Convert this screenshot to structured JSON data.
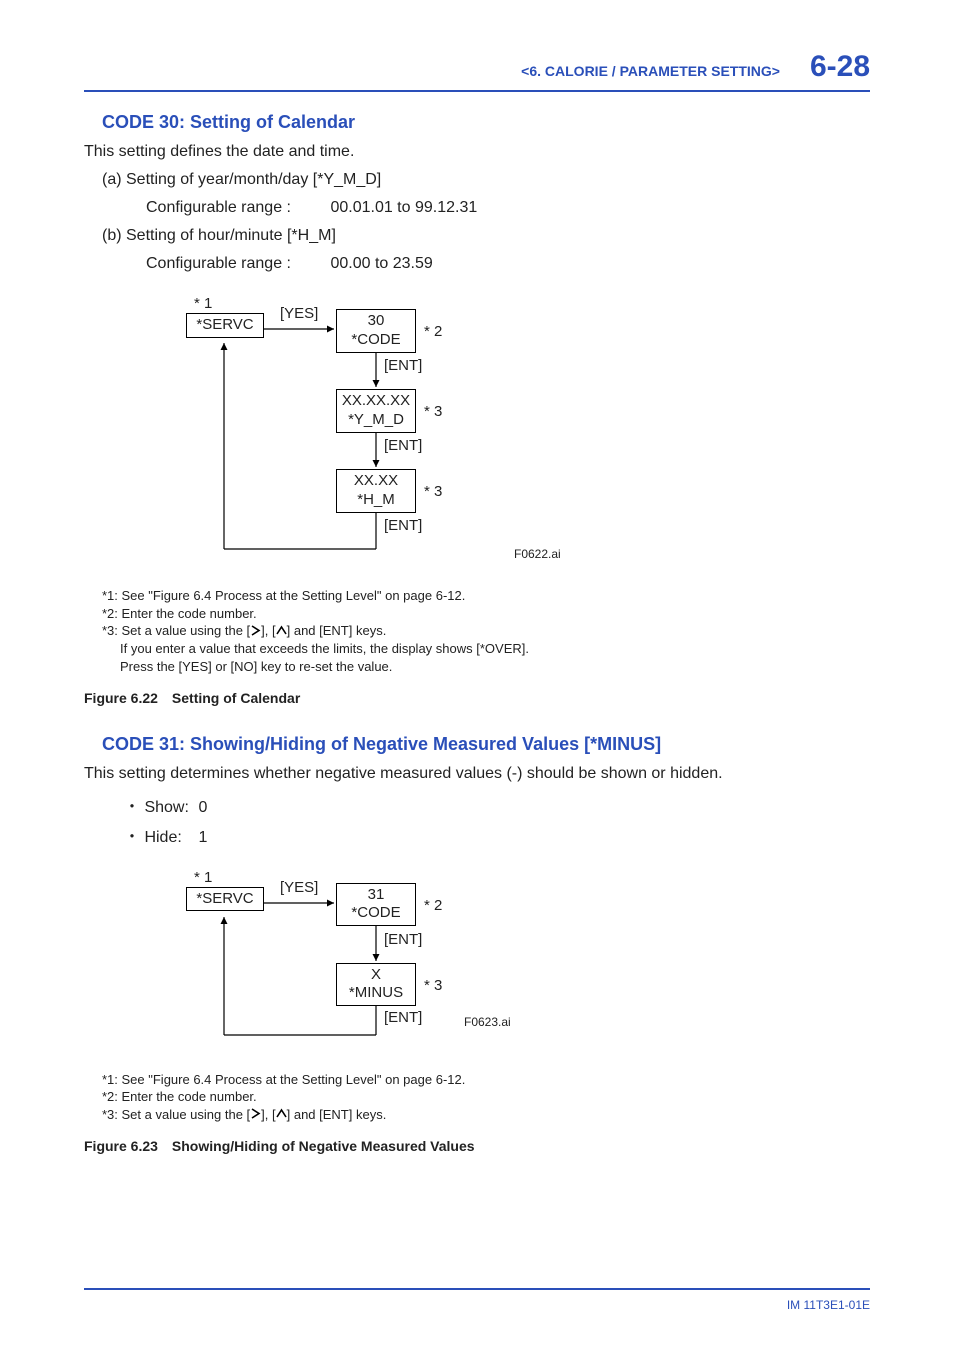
{
  "header": {
    "section": "<6. CALORIE / PARAMETER SETTING>",
    "page": "6-28"
  },
  "code30": {
    "title": "CODE 30: Setting of Calendar",
    "intro": "This setting defines the date and time.",
    "item_a": "(a) Setting of year/month/day [*Y_M_D]",
    "item_a_cfg_label": "Configurable range :",
    "item_a_cfg_value": "00.01.01 to 99.12.31",
    "item_b": "(b) Setting of hour/minute [*H_M]",
    "item_b_cfg_label": "Configurable range :",
    "item_b_cfg_value": "00.00 to 23.59",
    "flow": {
      "star1": "* 1",
      "servc": "*SERVC",
      "yes": "[YES]",
      "code_top": "30",
      "code_bot": "*CODE",
      "star2": "* 2",
      "ent": "[ENT]",
      "ymd_top": "XX.XX.XX",
      "ymd_bot": "*Y_M_D",
      "star3a": "* 3",
      "hm_top": "XX.XX",
      "hm_bot": "*H_M",
      "star3b": "* 3",
      "img_ref": "F0622.ai"
    },
    "notes": {
      "n1": "*1: See \"Figure 6.4 Process at the Setting Level\" on page 6-12.",
      "n2": "*2: Enter the code number.",
      "n3": "*3: Set a value using the [",
      "n3_cont": "] and [ENT] keys.",
      "n3_mid": "], [",
      "n3b": "If you enter a value that exceeds the limits, the display shows [*OVER].",
      "n3c": "Press the [YES] or [NO] key to re-set the value."
    },
    "caption": "Figure 6.22 Setting of Calendar"
  },
  "code31": {
    "title_main": "CODE 31: Showing/Hiding of Negative Measured Values",
    "title_suffix": "[*MINUS]",
    "intro": "This setting determines whether negative measured values (-) should be shown or hidden.",
    "show_label": "・ Show:",
    "show_val": "0",
    "hide_label": "・ Hide:",
    "hide_val": "1",
    "flow": {
      "star1": "* 1",
      "servc": "*SERVC",
      "yes": "[YES]",
      "code_top": "31",
      "code_bot": "*CODE",
      "star2": "* 2",
      "ent": "[ENT]",
      "minus_top": "X",
      "minus_bot": "*MINUS",
      "star3": "* 3",
      "img_ref": "F0623.ai"
    },
    "notes": {
      "n1": "*1: See \"Figure 6.4 Process at the Setting Level\" on page 6-12.",
      "n2": "*2: Enter the code number.",
      "n3": "*3: Set a value using the [",
      "n3_mid": "], [",
      "n3_cont": "] and [ENT] keys."
    },
    "caption": "Figure 6.23 Showing/Hiding of Negative Measured Values"
  },
  "footer": {
    "doc_id": "IM 11T3E1-01E"
  },
  "glyph": {
    "gt": ">",
    "caret": "∧"
  }
}
